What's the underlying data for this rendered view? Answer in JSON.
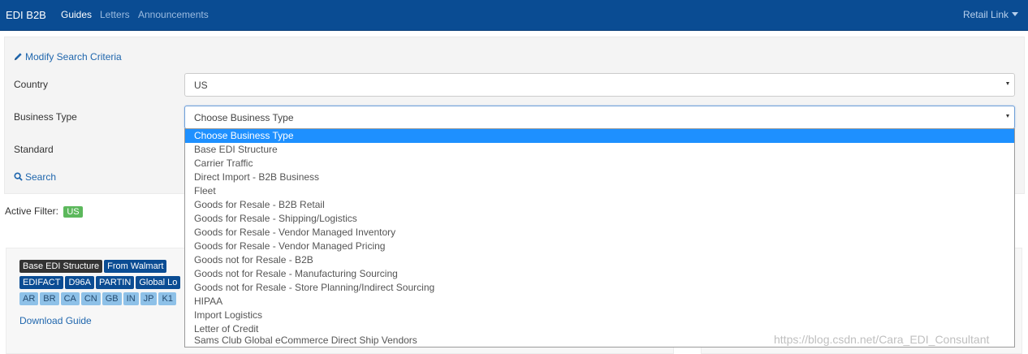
{
  "navbar": {
    "brand": "EDI B2B",
    "links": [
      {
        "label": "Guides",
        "active": true
      },
      {
        "label": "Letters",
        "active": false
      },
      {
        "label": "Announcements",
        "active": false
      }
    ],
    "user_menu": "Retail Link"
  },
  "search": {
    "modify_label": "Modify Search Criteria",
    "country": {
      "label": "Country",
      "value": "US"
    },
    "business_type": {
      "label": "Business Type",
      "value": "Choose Business Type"
    },
    "standard": {
      "label": "Standard"
    },
    "search_label": "Search"
  },
  "active_filter": {
    "label": "Active Filter:",
    "badge": "US"
  },
  "card": {
    "row1": [
      "Base EDI Structure",
      "From Walmart"
    ],
    "row2": [
      "EDIFACT",
      "D96A",
      "PARTIN",
      "Global Lo"
    ],
    "row3": [
      "AR",
      "BR",
      "CA",
      "CN",
      "GB",
      "IN",
      "JP",
      "K1"
    ],
    "download": "Download Guide"
  },
  "dropdown_options": [
    "Choose Business Type",
    "Base EDI Structure",
    "Carrier Traffic",
    "Direct Import - B2B Business",
    "Fleet",
    "Goods for Resale - B2B Retail",
    "Goods for Resale - Shipping/Logistics",
    "Goods for Resale - Vendor Managed Inventory",
    "Goods for Resale - Vendor Managed Pricing",
    "Goods not for Resale - B2B",
    "Goods not for Resale - Manufacturing Sourcing",
    "Goods not for Resale - Store Planning/Indirect Sourcing",
    "HIPAA",
    "Import Logistics",
    "Letter of Credit",
    "Sams Club Global eCommerce Direct Ship Vendors"
  ],
  "selected_option": "Choose Business Type",
  "watermark": "https://blog.csdn.net/Cara_EDI_Consultant",
  "colors": {
    "navbar": "#0a4c93",
    "selected": "#1e90ff",
    "tag_dark": "#333333",
    "tag_blue": "#0a4c93",
    "tag_light": "#8ec1e8",
    "badge": "#5cb85c"
  }
}
